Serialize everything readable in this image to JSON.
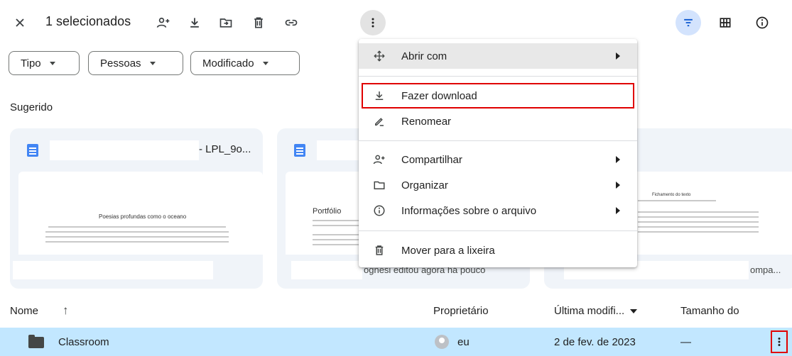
{
  "toolbar": {
    "selected_label": "1 selecionados"
  },
  "filters": [
    {
      "label": "Tipo"
    },
    {
      "label": "Pessoas"
    },
    {
      "label": "Modificado"
    }
  ],
  "suggested": {
    "title": "Sugerido",
    "cards": [
      {
        "title_suffix": "- LPL_9o...",
        "preview_heading": "Poesias profundas como o oceano"
      },
      {
        "preview_heading": "Portfólio",
        "bottom_text": "ognesi editou agora há pouco"
      },
      {
        "preview_heading": "Fichamento do texto",
        "bottom_text": "ompa..."
      }
    ]
  },
  "table": {
    "headers": {
      "name": "Nome",
      "owner": "Proprietário",
      "modified": "Última modifi...",
      "size": "Tamanho do"
    },
    "rows": [
      {
        "name": "Classroom",
        "owner": "eu",
        "modified": "2 de fev. de 2023",
        "size": "—"
      }
    ]
  },
  "context_menu": {
    "items": [
      {
        "label": "Abrir com",
        "icon": "move-arrows-icon",
        "submenu": true
      },
      {
        "label": "Fazer download",
        "icon": "download-icon",
        "submenu": false
      },
      {
        "label": "Renomear",
        "icon": "pencil-icon",
        "submenu": false
      },
      {
        "label": "Compartilhar",
        "icon": "add-person-icon",
        "submenu": true
      },
      {
        "label": "Organizar",
        "icon": "folder-icon",
        "submenu": true
      },
      {
        "label": "Informações sobre o arquivo",
        "icon": "info-icon",
        "submenu": true
      },
      {
        "label": "Mover para a lixeira",
        "icon": "trash-icon",
        "submenu": false
      }
    ]
  },
  "colors": {
    "selected_row": "#c2e7ff",
    "filter_active": "#d3e3fd",
    "highlight": "#e00000",
    "doc_icon": "#4285f4"
  }
}
